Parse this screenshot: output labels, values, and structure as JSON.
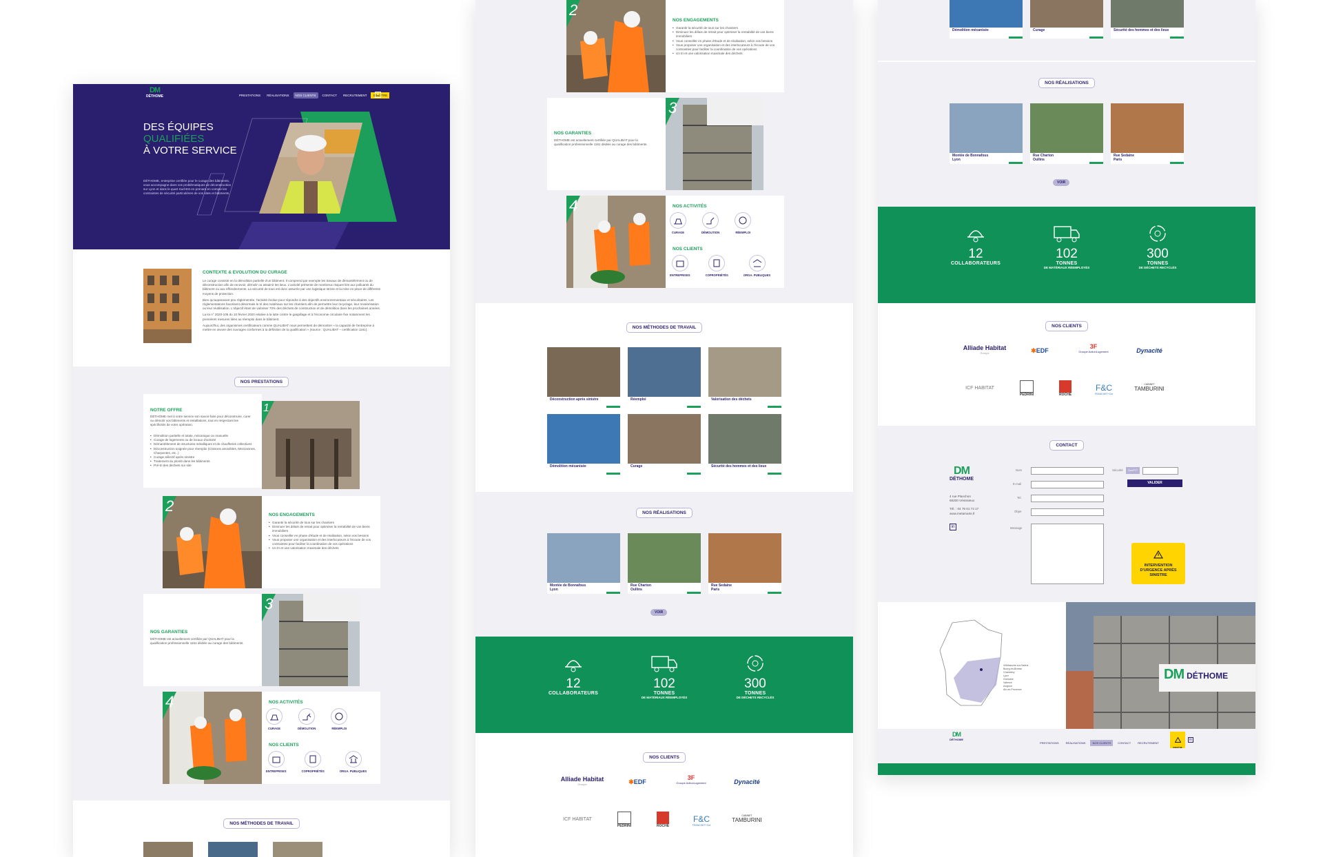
{
  "brand": {
    "logo": "DM",
    "name": "DÉTHOME",
    "green": "#1b9f5a",
    "navy": "#2a1f6e",
    "stats_green": "#0f9157",
    "yellow": "#ffd400"
  },
  "nav": {
    "items": [
      "Prestations",
      "Réalisations",
      "Nos clients",
      "Contact",
      "Recrutement",
      "Sinistre"
    ],
    "active": "Nos clients"
  },
  "hero": {
    "line1": "DES ÉQUIPES",
    "line2": "QUALIFIÉES",
    "line3": "À VOTRE SERVICE",
    "desc": "DÉTHOME, entreprise certifiée pour le curage des bâtiments, vous accompagne dans vos problématiques de déconstruction sur Lyon et dans le quart Sud-Est en prenant en compte les contraintes de sécurité particulières de vos sites et bâtiments."
  },
  "context": {
    "title": "CONTEXTE & EVOLUTION DU CURAGE",
    "p1": "Le curage consiste en la démolition partielle d'un bâtiment. Il comprend par exemple les travaux de démantèlement ou de déconstruction afin de recevoir, démolir ou assainir les lieux. L'activité présente de nombreux risques liés aux polluants du bâtiment ou aux effondrements. La sécurité de tous est donc assurée par une logistique stricte et la mise en place de différents moyens de protection.",
    "p2": "Bien qu'auparavant peu réglementée, l'activité évolue pour répondre à des objectifs environnementaux et sécuritaires. Les réglementations favorisent désormais le tri des matériaux sur les chantiers afin de permettre leur recyclage, leur revalorisation ou leur réutilisation. L'objectif étant de valoriser 70% des déchets de construction et de démolition dans les prochaines années.",
    "p3": "La loi n° 2020-105 du 10 février 2020 relative à la lutte contre le gaspillage et à l'économie circulaire fixe notamment les premières mesures liées au réemploi dans le bâtiment.",
    "p4": "Aujourd'hui, des organismes certificateurs comme QUALIBAT nous permettent de démontrer « la capacité de l'entreprise à mettre en œuvre des ouvrages conformes à la définition de la qualification » (source : QUALIBAT – certification 1161)."
  },
  "sections": {
    "prestations": "NOS PRESTATIONS",
    "methodes": "NOS MÉTHODES DE TRAVAIL",
    "realisations": "NOS RÉALISATIONS",
    "clients": "NOS CLIENTS",
    "contact": "CONTACT"
  },
  "offer": {
    "title": "NOTRE OFFRE",
    "intro": "DÉTHOME met à votre service son savoir-faire pour déconstruire, curer ou démolir vos bâtiments et installations, tout en respectant les spécificités de votre opération.",
    "items": [
      "Démolition partielle et totale, mécanique ou manuelle",
      "Curage de logements ou de locaux d'activité",
      "Démantèlement de structures métalliques et de chaufferies collectives",
      "Déconstruction soignée pour réemploi (Cloisons amovibles, Mezzanines, Charpentes, etc..)",
      "Curage sélectif après sinistre",
      "Traitement du plomb dans les bâtiments",
      "Pré-tri des déchets sur site"
    ]
  },
  "engagements": {
    "title": "NOS ENGAGEMENTS",
    "items": [
      "Garantir la sécurité de tous sur les chantiers",
      "Diminuer les délais de retrait pour optimiser la rentabilité de vos biens immobiliers",
      "Vous conseiller en phase d'étude et de réalisation, selon vos besoins",
      "Vous proposer une organisation et des interlocuteurs à l'écoute de vos contraintes pour faciliter la coordination de vos opérations",
      "Un tri et une valorisation maximale des déchets"
    ]
  },
  "garanties": {
    "title": "NOS GARANTIES",
    "text": "DÉTHOME est actuellement certifiée par QUALIBAT pour la qualification professionnelle 1161 dédiée au curage des bâtiments."
  },
  "activites": {
    "title": "NOS ACTIVITÉS",
    "items": [
      "Curage",
      "Démolition",
      "Réemploi"
    ]
  },
  "clients_types": {
    "title": "NOS CLIENTS",
    "items": [
      "Entreprises",
      "Copropriétés",
      "Orga. publiques"
    ]
  },
  "numbers": [
    "1",
    "2",
    "3",
    "4"
  ],
  "methods": [
    "Déconstruction après sinistre",
    "Réemploi",
    "Valorisation des déchets",
    "Démolition mécanisée",
    "Curage",
    "Sécurité des hommes et des lieux"
  ],
  "realisations": [
    {
      "name": "Montée de Bonnafous",
      "city": "Lyon"
    },
    {
      "name": "Rue Charton",
      "city": "Oullins"
    },
    {
      "name": "Rue Sedaine",
      "city": "Paris"
    }
  ],
  "voir": "VOIR",
  "stats": [
    {
      "value": "12",
      "label": "COLLABORATEURS",
      "sub": ""
    },
    {
      "value": "102",
      "label": "TONNES",
      "sub": "DE MATÉRIAUX RÉEMPLOYÉS"
    },
    {
      "value": "300",
      "label": "TONNES",
      "sub": "DE DÉCHETS RECYCLÉS"
    }
  ],
  "client_logos": [
    "Alliade Habitat",
    "EDF",
    "3F",
    "Dynacité",
    "ICF HABITAT",
    "PEDRINI",
    "ROCHE",
    "F&C",
    "TAMBURINI"
  ],
  "client_logo_sub": {
    "alliade": "Groupe",
    "3f": "Groupe ActionLogement",
    "fc": "FRANCHET+Cie",
    "tamburini": "CABINET"
  },
  "contact": {
    "address1": "4 rue Planchon",
    "address2": "69200 Vénissieux",
    "phone": "Tél. : 04 78 01 74 17",
    "web": "www.metamarie.fr",
    "fields": [
      "Nom",
      "E-mail",
      "Tel.",
      "Objet",
      "Message"
    ],
    "security": "Sécurité",
    "captcha": "SzeP77",
    "submit": "VALIDER",
    "urgence": "INTERVENTION D'URGENCE APRÈS SINISTRE"
  },
  "map_cities": [
    "Villefranche-sur-Saône",
    "Bourg-en-Bresse",
    "Chambéry",
    "Lyon",
    "Grenoble",
    "Valence",
    "Avignon",
    "Aix-en-Provence"
  ]
}
